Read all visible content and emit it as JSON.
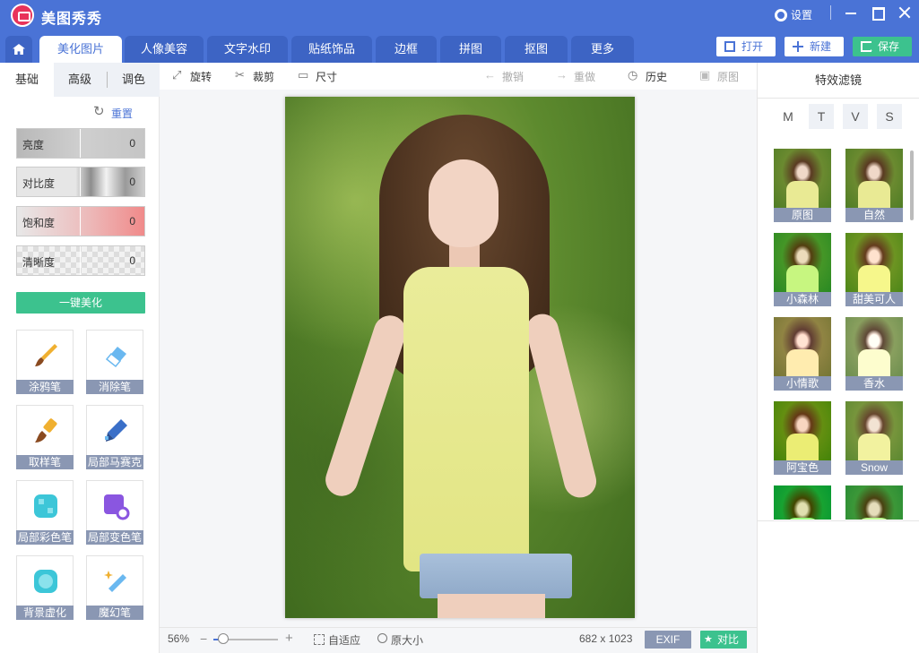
{
  "app": {
    "title": "美图秀秀",
    "settings_label": "设置"
  },
  "tabs": [
    {
      "label": "美化图片",
      "active": true
    },
    {
      "label": "人像美容"
    },
    {
      "label": "文字水印"
    },
    {
      "label": "贴纸饰品"
    },
    {
      "label": "边框"
    },
    {
      "label": "拼图"
    },
    {
      "label": "抠图"
    },
    {
      "label": "更多"
    }
  ],
  "header_buttons": {
    "open": "打开",
    "new": "新建",
    "save": "保存"
  },
  "left_panel": {
    "subtabs": [
      "基础",
      "高级",
      "调色"
    ],
    "reset": "重置",
    "sliders": [
      {
        "label": "亮度",
        "value": "0"
      },
      {
        "label": "对比度",
        "value": "0"
      },
      {
        "label": "饱和度",
        "value": "0"
      },
      {
        "label": "清晰度",
        "value": "0"
      }
    ],
    "beautify_button": "一键美化",
    "tools": [
      "涂鸦笔",
      "消除笔",
      "取样笔",
      "局部马赛克",
      "局部彩色笔",
      "局部变色笔",
      "背景虚化",
      "魔幻笔"
    ]
  },
  "toolbar": {
    "rotate": "旋转",
    "crop": "裁剪",
    "size": "尺寸",
    "undo": "撤销",
    "redo": "重做",
    "history": "历史",
    "original": "原图"
  },
  "status": {
    "zoom": "56%",
    "zoom_level": 0.56,
    "fit": "自适应",
    "actual_size": "原大小",
    "dimensions": "682 x 1023",
    "exif": "EXIF",
    "compare": "对比"
  },
  "right_panel": {
    "title": "特效滤镜",
    "categories": [
      "M",
      "T",
      "V",
      "S"
    ],
    "filters": [
      "原图",
      "自然",
      "小森林",
      "甜美可人",
      "小情歌",
      "香水",
      "阿宝色",
      "Snow"
    ]
  },
  "colors": {
    "brand_blue": "#4a73d6",
    "green": "#3cc28e",
    "label_gray": "#8a97b3"
  }
}
